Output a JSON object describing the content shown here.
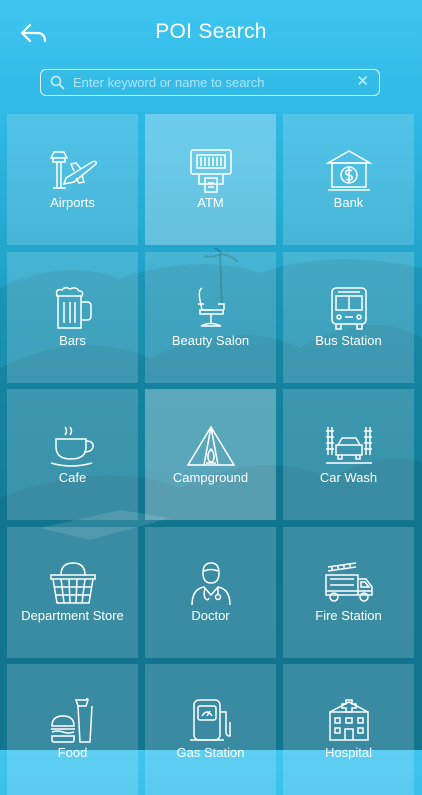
{
  "header": {
    "title": "POI Search"
  },
  "search": {
    "placeholder": "Enter keyword or name to search",
    "value": ""
  },
  "categories": [
    {
      "label": "Airports",
      "icon": "airport-icon"
    },
    {
      "label": "ATM",
      "icon": "atm-icon"
    },
    {
      "label": "Bank",
      "icon": "bank-icon"
    },
    {
      "label": "Bars",
      "icon": "beer-mug-icon"
    },
    {
      "label": "Beauty Salon",
      "icon": "salon-chair-icon"
    },
    {
      "label": "Bus Station",
      "icon": "bus-icon"
    },
    {
      "label": "Cafe",
      "icon": "coffee-cup-icon"
    },
    {
      "label": "Campground",
      "icon": "tent-icon"
    },
    {
      "label": "Car Wash",
      "icon": "car-wash-icon"
    },
    {
      "label": "Department Store",
      "icon": "basket-icon"
    },
    {
      "label": "Doctor",
      "icon": "doctor-icon"
    },
    {
      "label": "Fire Station",
      "icon": "fire-truck-icon"
    },
    {
      "label": "Food",
      "icon": "fast-food-icon"
    },
    {
      "label": "Gas Station",
      "icon": "fuel-pump-icon"
    },
    {
      "label": "Hospital",
      "icon": "hospital-icon"
    }
  ],
  "colors": {
    "accent": "#2db6e2",
    "text": "#ffffff"
  }
}
